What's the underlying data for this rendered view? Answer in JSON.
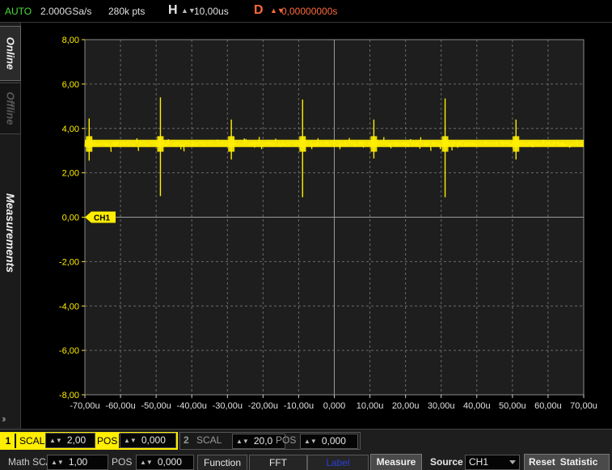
{
  "topbar": {
    "mode": "AUTO",
    "sample_rate": "2.000GSa/s",
    "points": "280k pts",
    "h_label": "H",
    "h_value": "10,00us",
    "d_label": "D",
    "d_value": "0,00000000s"
  },
  "sidebar": {
    "tabs": [
      {
        "label": "Online",
        "active": true
      },
      {
        "label": "Offline",
        "active": false
      }
    ],
    "measurements_label": "Measurements"
  },
  "chart_data": {
    "type": "line",
    "x_tick_labels": [
      "-70,00u",
      "-60,00u",
      "-50,00u",
      "-40,00u",
      "-30,00u",
      "-20,00u",
      "-10,00u",
      "0,000",
      "10,00u",
      "20,00u",
      "30,00u",
      "40,00u",
      "50,00u",
      "60,00u",
      "70,00u"
    ],
    "y_tick_labels": [
      "8,00",
      "6,00",
      "4,00",
      "2,00",
      "0,00",
      "-2,00",
      "-4,00",
      "-6,00",
      "-8,00"
    ],
    "xlim_us": [
      -70,
      70
    ],
    "ylim": [
      -8,
      8
    ],
    "grid": true,
    "grid_style": "dashed",
    "series": [
      {
        "name": "CH1",
        "color": "#ffee00",
        "baseline": 3.3,
        "noise_band": [
          3.05,
          3.6
        ],
        "spikes": [
          {
            "x_us": -68.8,
            "high": 4.45,
            "low": 2.55
          },
          {
            "x_us": -48.8,
            "high": 5.4,
            "low": 0.95
          },
          {
            "x_us": -28.9,
            "high": 4.4,
            "low": 2.6
          },
          {
            "x_us": -8.9,
            "high": 5.3,
            "low": 0.9
          },
          {
            "x_us": 11.1,
            "high": 4.4,
            "low": 2.65
          },
          {
            "x_us": 31.1,
            "high": 5.35,
            "low": 0.9
          },
          {
            "x_us": 51.0,
            "high": 4.4,
            "low": 2.6
          }
        ]
      }
    ],
    "marker": {
      "label": "CH1",
      "y": 0.0,
      "color": "#ffee00"
    }
  },
  "controls": {
    "ch1": {
      "num": "1",
      "scal_label": "SCAL",
      "scal_value": "2,00",
      "pos_label": "POS",
      "pos_value": "0,000"
    },
    "ch2": {
      "num": "2",
      "scal_label": "SCAL",
      "scal_value": "20,0",
      "pos_label": "POS",
      "pos_value": "0,000"
    },
    "math": {
      "scal_label": "Math SCAL",
      "scal_value": "1,00",
      "pos_label": "POS",
      "pos_value": "0,000"
    },
    "function_label": "Function",
    "fft_label": "FFT",
    "label_label": "Label",
    "measure_label": "Measure",
    "source_label": "Source",
    "source_value": "CH1",
    "reset_label": "Reset",
    "statistic_label": "Statistic",
    "updown_arrow": "▲▼"
  },
  "colors": {
    "ch1": "#ffee00",
    "delay": "#ff6a3c",
    "mode": "#4cdc3c",
    "grid": "#6a6a6a",
    "plot_bg": "#1e1e1e",
    "label_btn": "#2a3fd6"
  }
}
